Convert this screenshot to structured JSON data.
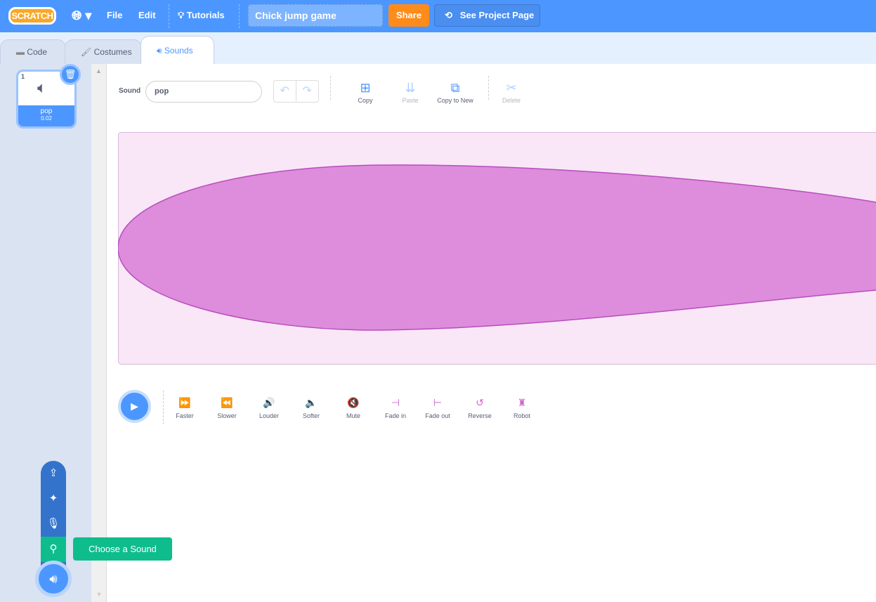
{
  "menubar": {
    "logo": "SCRATCH",
    "file": "File",
    "edit": "Edit",
    "tutorials": "Tutorials",
    "project_title": "Chick jump game",
    "share": "Share",
    "see_project_page": "See Project Page"
  },
  "tabs": [
    {
      "label": "Code"
    },
    {
      "label": "Costumes"
    },
    {
      "label": "Sounds",
      "active": true
    }
  ],
  "sounds": [
    {
      "index": "1",
      "name": "pop",
      "duration": "0.02",
      "selected": true
    }
  ],
  "editor": {
    "sound_label": "Sound",
    "sound_name": "pop",
    "tools": [
      {
        "label": "Copy",
        "enabled": true,
        "icon": "copy-icon"
      },
      {
        "label": "Paste",
        "enabled": false,
        "icon": "paste-icon"
      },
      {
        "label": "Copy to New",
        "enabled": true,
        "icon": "copy-to-new-icon"
      },
      {
        "label": "Delete",
        "enabled": false,
        "icon": "scissors-icon"
      }
    ],
    "effects": [
      {
        "label": "Faster",
        "icon": "⏩"
      },
      {
        "label": "Slower",
        "icon": "⏪"
      },
      {
        "label": "Louder",
        "icon": "🔊"
      },
      {
        "label": "Softer",
        "icon": "🔈"
      },
      {
        "label": "Mute",
        "icon": "🔇"
      },
      {
        "label": "Fade in",
        "icon": "⊣"
      },
      {
        "label": "Fade out",
        "icon": "⊢"
      },
      {
        "label": "Reverse",
        "icon": "↺"
      },
      {
        "label": "Robot",
        "icon": "♜"
      }
    ]
  },
  "tooltip": "Choose a Sound",
  "colors": {
    "accent": "#4c97ff",
    "share": "#ff8c1a",
    "effect": "#cf63cf",
    "tooltip": "#0fbd8c",
    "waveform_fill": "#dd8ddb",
    "waveform_stroke": "#b94cbe"
  }
}
